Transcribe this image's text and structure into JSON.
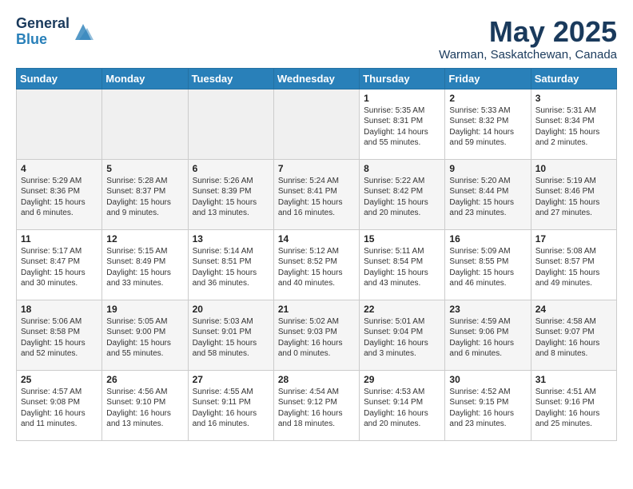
{
  "header": {
    "logo_line1": "General",
    "logo_line2": "Blue",
    "title": "May 2025",
    "location": "Warman, Saskatchewan, Canada"
  },
  "weekdays": [
    "Sunday",
    "Monday",
    "Tuesday",
    "Wednesday",
    "Thursday",
    "Friday",
    "Saturday"
  ],
  "weeks": [
    [
      {
        "day": "",
        "empty": true
      },
      {
        "day": "",
        "empty": true
      },
      {
        "day": "",
        "empty": true
      },
      {
        "day": "",
        "empty": true
      },
      {
        "day": "1",
        "lines": [
          "Sunrise: 5:35 AM",
          "Sunset: 8:31 PM",
          "Daylight: 14 hours",
          "and 55 minutes."
        ]
      },
      {
        "day": "2",
        "lines": [
          "Sunrise: 5:33 AM",
          "Sunset: 8:32 PM",
          "Daylight: 14 hours",
          "and 59 minutes."
        ]
      },
      {
        "day": "3",
        "lines": [
          "Sunrise: 5:31 AM",
          "Sunset: 8:34 PM",
          "Daylight: 15 hours",
          "and 2 minutes."
        ]
      }
    ],
    [
      {
        "day": "4",
        "lines": [
          "Sunrise: 5:29 AM",
          "Sunset: 8:36 PM",
          "Daylight: 15 hours",
          "and 6 minutes."
        ]
      },
      {
        "day": "5",
        "lines": [
          "Sunrise: 5:28 AM",
          "Sunset: 8:37 PM",
          "Daylight: 15 hours",
          "and 9 minutes."
        ]
      },
      {
        "day": "6",
        "lines": [
          "Sunrise: 5:26 AM",
          "Sunset: 8:39 PM",
          "Daylight: 15 hours",
          "and 13 minutes."
        ]
      },
      {
        "day": "7",
        "lines": [
          "Sunrise: 5:24 AM",
          "Sunset: 8:41 PM",
          "Daylight: 15 hours",
          "and 16 minutes."
        ]
      },
      {
        "day": "8",
        "lines": [
          "Sunrise: 5:22 AM",
          "Sunset: 8:42 PM",
          "Daylight: 15 hours",
          "and 20 minutes."
        ]
      },
      {
        "day": "9",
        "lines": [
          "Sunrise: 5:20 AM",
          "Sunset: 8:44 PM",
          "Daylight: 15 hours",
          "and 23 minutes."
        ]
      },
      {
        "day": "10",
        "lines": [
          "Sunrise: 5:19 AM",
          "Sunset: 8:46 PM",
          "Daylight: 15 hours",
          "and 27 minutes."
        ]
      }
    ],
    [
      {
        "day": "11",
        "lines": [
          "Sunrise: 5:17 AM",
          "Sunset: 8:47 PM",
          "Daylight: 15 hours",
          "and 30 minutes."
        ]
      },
      {
        "day": "12",
        "lines": [
          "Sunrise: 5:15 AM",
          "Sunset: 8:49 PM",
          "Daylight: 15 hours",
          "and 33 minutes."
        ]
      },
      {
        "day": "13",
        "lines": [
          "Sunrise: 5:14 AM",
          "Sunset: 8:51 PM",
          "Daylight: 15 hours",
          "and 36 minutes."
        ]
      },
      {
        "day": "14",
        "lines": [
          "Sunrise: 5:12 AM",
          "Sunset: 8:52 PM",
          "Daylight: 15 hours",
          "and 40 minutes."
        ]
      },
      {
        "day": "15",
        "lines": [
          "Sunrise: 5:11 AM",
          "Sunset: 8:54 PM",
          "Daylight: 15 hours",
          "and 43 minutes."
        ]
      },
      {
        "day": "16",
        "lines": [
          "Sunrise: 5:09 AM",
          "Sunset: 8:55 PM",
          "Daylight: 15 hours",
          "and 46 minutes."
        ]
      },
      {
        "day": "17",
        "lines": [
          "Sunrise: 5:08 AM",
          "Sunset: 8:57 PM",
          "Daylight: 15 hours",
          "and 49 minutes."
        ]
      }
    ],
    [
      {
        "day": "18",
        "lines": [
          "Sunrise: 5:06 AM",
          "Sunset: 8:58 PM",
          "Daylight: 15 hours",
          "and 52 minutes."
        ]
      },
      {
        "day": "19",
        "lines": [
          "Sunrise: 5:05 AM",
          "Sunset: 9:00 PM",
          "Daylight: 15 hours",
          "and 55 minutes."
        ]
      },
      {
        "day": "20",
        "lines": [
          "Sunrise: 5:03 AM",
          "Sunset: 9:01 PM",
          "Daylight: 15 hours",
          "and 58 minutes."
        ]
      },
      {
        "day": "21",
        "lines": [
          "Sunrise: 5:02 AM",
          "Sunset: 9:03 PM",
          "Daylight: 16 hours",
          "and 0 minutes."
        ]
      },
      {
        "day": "22",
        "lines": [
          "Sunrise: 5:01 AM",
          "Sunset: 9:04 PM",
          "Daylight: 16 hours",
          "and 3 minutes."
        ]
      },
      {
        "day": "23",
        "lines": [
          "Sunrise: 4:59 AM",
          "Sunset: 9:06 PM",
          "Daylight: 16 hours",
          "and 6 minutes."
        ]
      },
      {
        "day": "24",
        "lines": [
          "Sunrise: 4:58 AM",
          "Sunset: 9:07 PM",
          "Daylight: 16 hours",
          "and 8 minutes."
        ]
      }
    ],
    [
      {
        "day": "25",
        "lines": [
          "Sunrise: 4:57 AM",
          "Sunset: 9:08 PM",
          "Daylight: 16 hours",
          "and 11 minutes."
        ]
      },
      {
        "day": "26",
        "lines": [
          "Sunrise: 4:56 AM",
          "Sunset: 9:10 PM",
          "Daylight: 16 hours",
          "and 13 minutes."
        ]
      },
      {
        "day": "27",
        "lines": [
          "Sunrise: 4:55 AM",
          "Sunset: 9:11 PM",
          "Daylight: 16 hours",
          "and 16 minutes."
        ]
      },
      {
        "day": "28",
        "lines": [
          "Sunrise: 4:54 AM",
          "Sunset: 9:12 PM",
          "Daylight: 16 hours",
          "and 18 minutes."
        ]
      },
      {
        "day": "29",
        "lines": [
          "Sunrise: 4:53 AM",
          "Sunset: 9:14 PM",
          "Daylight: 16 hours",
          "and 20 minutes."
        ]
      },
      {
        "day": "30",
        "lines": [
          "Sunrise: 4:52 AM",
          "Sunset: 9:15 PM",
          "Daylight: 16 hours",
          "and 23 minutes."
        ]
      },
      {
        "day": "31",
        "lines": [
          "Sunrise: 4:51 AM",
          "Sunset: 9:16 PM",
          "Daylight: 16 hours",
          "and 25 minutes."
        ]
      }
    ]
  ]
}
